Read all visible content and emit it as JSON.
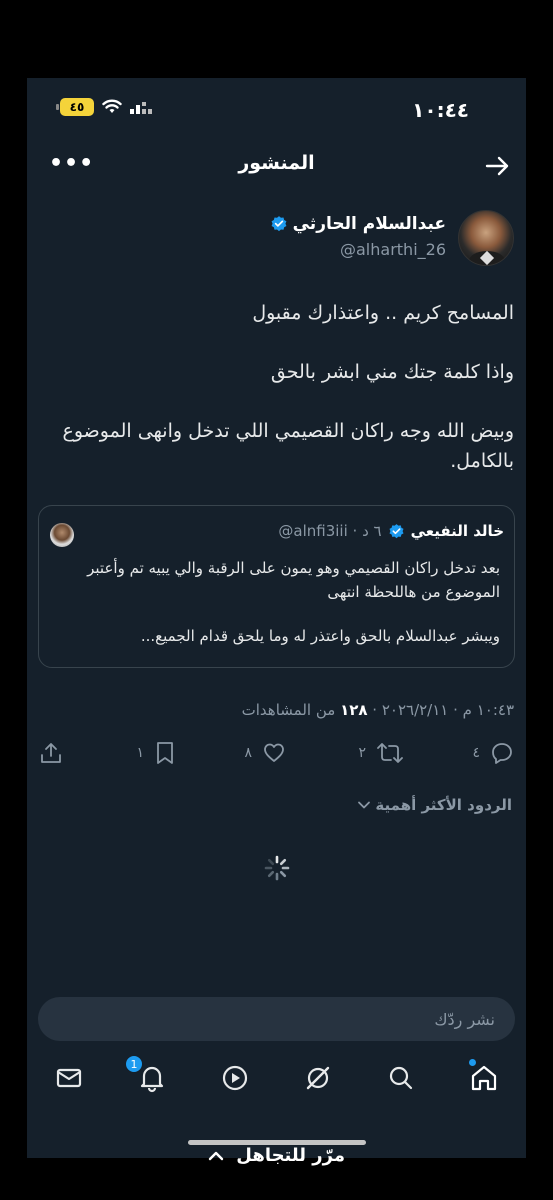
{
  "status_bar": {
    "time": "١٠:٤٤",
    "battery": "٤٥"
  },
  "header": {
    "title": "المنشور",
    "more_glyph": "•••"
  },
  "author": {
    "name": "عبدالسلام الحارثي",
    "handle": "@alharthi_26"
  },
  "tweet": {
    "paragraphs": [
      "المسامح كريم .. واعتذارك مقبول",
      "واذا كلمة جتك مني ابشر بالحق",
      "وبيض الله وجه راكان القصيمي اللي تدخل وانهى الموضوع بالكامل."
    ]
  },
  "quote": {
    "name": "خالد النفيعي",
    "meta": "@alnfi3iii · ٦ د",
    "line1": "بعد تدخل راكان القصيمي وهو يمون على الرقبة والي يبيه تم وأعتبر الموضوع من هاللحظة انتهى",
    "line2": "ويبشر عبدالسلام بالحق واعتذر له وما يلحق قدام الجميع..."
  },
  "meta": {
    "datetime": "١٠:٤٣ م · ٢٠٢٦/٢/١١ · ",
    "views_count": "١٢٨",
    "views_label": " من المشاهدات"
  },
  "actions": {
    "replies": "٤",
    "retweets": "٢",
    "likes": "٨",
    "bookmarks": "١"
  },
  "sort": {
    "label": "الردود الأكثر أهمية"
  },
  "reply": {
    "placeholder": "نشر ردّك"
  },
  "nav": {
    "notifications_badge": "1"
  },
  "skip": {
    "label": "مرّر للتجاهل"
  },
  "colors": {
    "background": "#15202b",
    "accent": "#1d9bf0",
    "text": "#e7e9ea",
    "muted": "#8b98a5"
  }
}
